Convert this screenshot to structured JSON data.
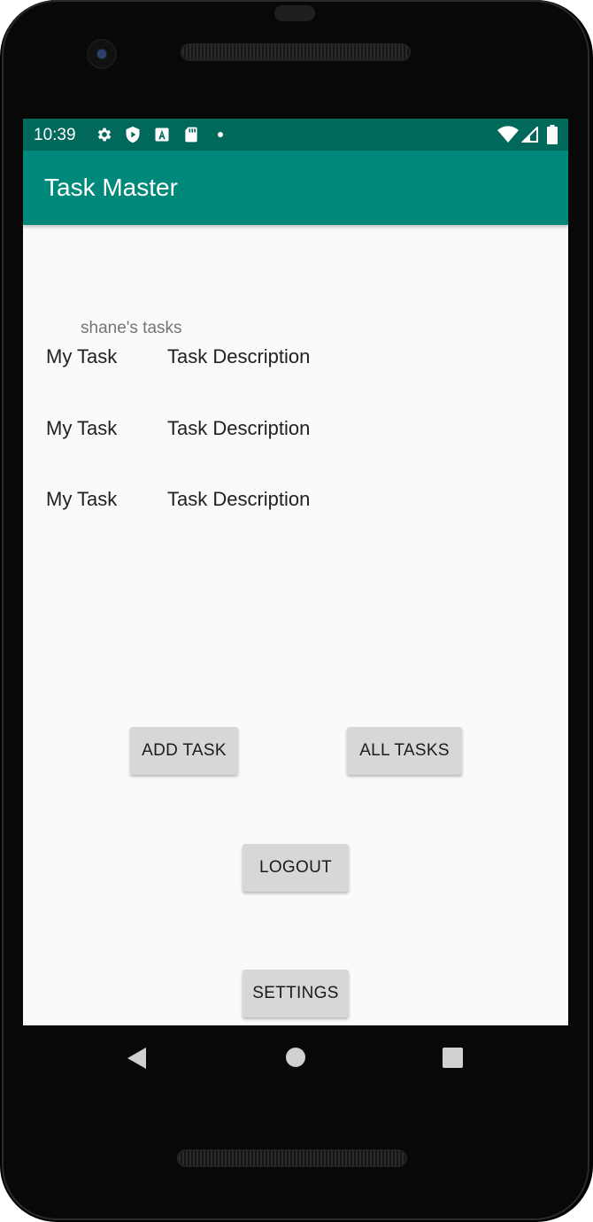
{
  "status_bar": {
    "time": "10:39",
    "left_icons": [
      "settings-icon",
      "shield-icon",
      "a-badge-icon",
      "sd-card-icon",
      "dot-icon"
    ],
    "right_icons": [
      "wifi-icon",
      "signal-icon",
      "battery-icon"
    ]
  },
  "app_bar": {
    "title": "Task Master"
  },
  "main": {
    "user_label": "shane's tasks",
    "tasks": [
      {
        "title": "My Task",
        "description": "Task Description"
      },
      {
        "title": "My Task",
        "description": "Task Description"
      },
      {
        "title": "My Task",
        "description": "Task Description"
      }
    ],
    "buttons": {
      "add_task": "ADD TASK",
      "all_tasks": "ALL TASKS",
      "logout": "LOGOUT",
      "settings": "SETTINGS"
    }
  },
  "nav_bar": {
    "icons": [
      "back-icon",
      "home-icon",
      "recents-icon"
    ]
  },
  "colors": {
    "status_bar": "#00695c",
    "app_bar": "#00897b",
    "background": "#fafafa",
    "button": "#d6d7d7"
  }
}
